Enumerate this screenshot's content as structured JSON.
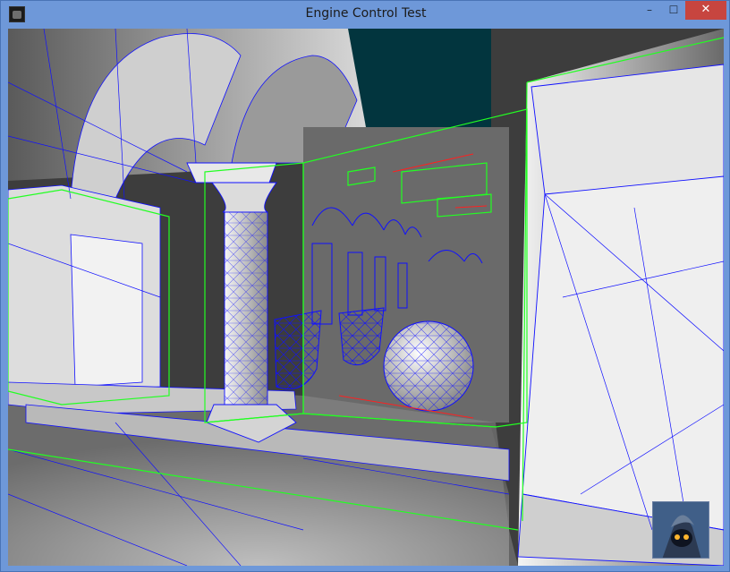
{
  "window": {
    "title": "Engine Control Test",
    "controls": {
      "minimize": "–",
      "maximize": "☐",
      "close": "✕"
    }
  },
  "viewport": {
    "render_mode": "wireframe overlay",
    "colors": {
      "mesh_wire": "#1010ff",
      "bounding_box": "#22ff22",
      "debug_line": "#ff2020",
      "sky": "#02353e",
      "frame": "#6e98d9"
    }
  },
  "overlay": {
    "avatar_icon": "wizard-avatar-icon"
  }
}
